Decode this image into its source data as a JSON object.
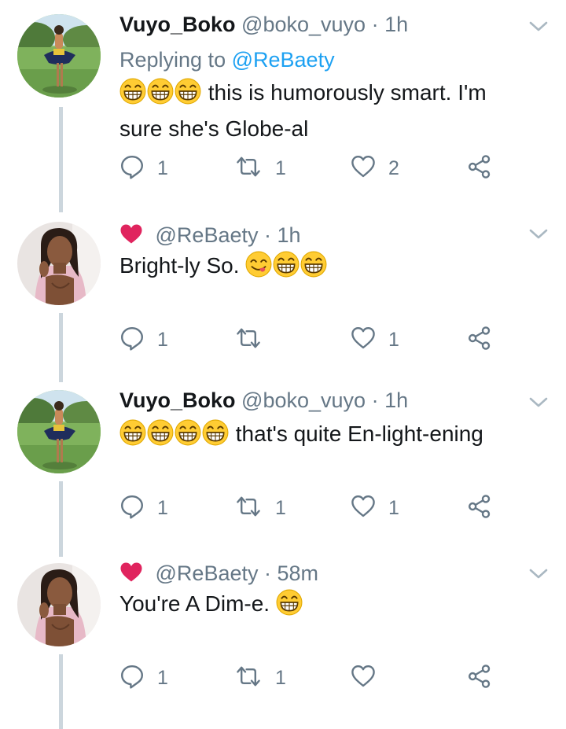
{
  "tweets": [
    {
      "kind": "named",
      "display_name": "Vuyo_Boko",
      "handle": "@boko_vuyo",
      "time": "1h",
      "replying_prefix": "Replying to",
      "replying_to": "@ReBaety",
      "emoji_count": 3,
      "text_line1": "this is humorously smart.  I'm",
      "text_line2": "sure she's Globe-al",
      "reply_count": "1",
      "retweet_count": "1",
      "like_count": "2"
    },
    {
      "kind": "liked",
      "handle": "@ReBaety",
      "time": "1h",
      "text": "Bright-ly So.",
      "emoji_after": [
        "yum-face",
        "grin-face",
        "grin-face"
      ],
      "reply_count": "1",
      "retweet_count": "",
      "like_count": "1"
    },
    {
      "kind": "named",
      "display_name": "Vuyo_Boko",
      "handle": "@boko_vuyo",
      "time": "1h",
      "emoji_count": 4,
      "text": "that's quite En-light-ening",
      "reply_count": "1",
      "retweet_count": "1",
      "like_count": "1"
    },
    {
      "kind": "liked",
      "handle": "@ReBaety",
      "time": "58m",
      "text": "You're A Dim-e.",
      "emoji_after": [
        "grin-face"
      ],
      "reply_count": "1",
      "retweet_count": "1",
      "like_count": ""
    }
  ],
  "colors": {
    "text": "#14171a",
    "secondary": "#657786",
    "link": "#1da1f2",
    "heart": "#e0245e",
    "thread_line": "#ccd6dd"
  },
  "icons": [
    "reply-icon",
    "retweet-icon",
    "like-icon",
    "share-icon",
    "chevron-down-icon",
    "heart-badge-icon"
  ]
}
